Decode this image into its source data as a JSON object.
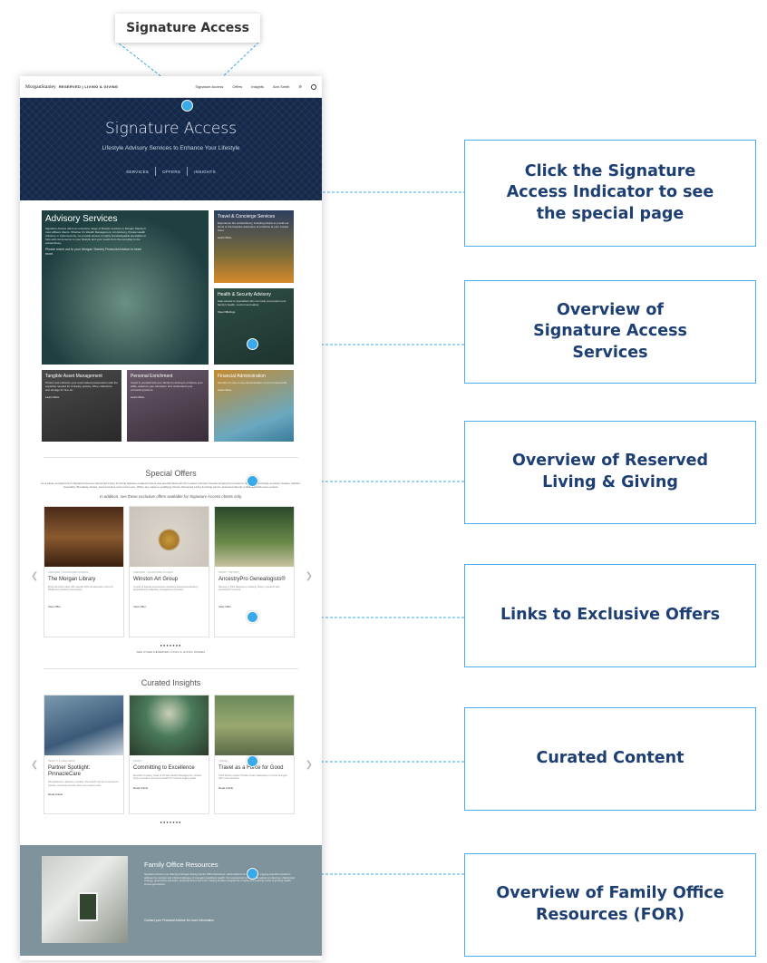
{
  "top_label": "Signature Access",
  "nav": {
    "logo": "MorganStanley",
    "brand": "RESERVED | LIVING & GIVING",
    "links": [
      "Signature Access",
      "Offers",
      "Insights",
      "Ann Smith"
    ]
  },
  "hero": {
    "title": "Signature Access",
    "subtitle": "Lifestyle Advisory Services to Enhance Your Lifestyle",
    "tabs": [
      "SERVICES",
      "OFFERS",
      "INSIGHTS"
    ]
  },
  "services": {
    "advisory": {
      "title": "Advisory Services",
      "body": "Signature Access offers an extensive range of lifestyle services to Morgan Stanley's most affluent clients. Whether it's Wealth Management, Art Advisory, Private Health Advisory or Cybersecurity, we provide access to highly knowledgeable specialists to help add convenience to your lifestyle and your needs from the everyday to the extraordinary.",
      "cta": "Please reach out to your Morgan Stanley Financial Advisor to learn more."
    },
    "travel": {
      "title": "Travel & Concierge Services",
      "body": "Experience the extraordinary, including tickets to a sold-out show or the bespoke adventure of a lifetime at your trusted hotel.",
      "link": "Learn More"
    },
    "health": {
      "title": "Health & Security Advisory",
      "body": "Gain access to specialists who can help you protect your family's health, comfort and safety.",
      "link": "View Offerings"
    },
    "tangible": {
      "title": "Tangible Asset Management",
      "body": "Protect and enhance your most valued possessions with the expertise needed for Antiquity, jewelry, Wine collections, and storage for fine art.",
      "link": "Learn More"
    },
    "personal": {
      "title": "Personal Enrichment",
      "body": "Invest in yourself and your family by aiming to enhance your skills, advance your education and understand your connecting factors.",
      "link": "Learn More"
    },
    "financial": {
      "title": "Financial Administration",
      "body": "Simplify the day to day administration of your financial life.",
      "link": "Learn More"
    }
  },
  "offers": {
    "title": "Special Offers",
    "intro": "As a value complement to Signature Access, Reserved Living & Giving features curated content and special discounts from select premium brands ranging from travel to rideshare, concierge services, theater, fashion, hospitality, Broadway shows, food and wine and much more. Offers are made to qualifying clients. Reserved Living & Giving can be accessed directly online and with some events.",
    "sub_intro": "In addition, see these exclusive offers available for Signature Access clients only.",
    "cards": [
      {
        "category": "CREATED | SIGNATURE ACCESS",
        "name": "The Morgan Library",
        "desc": "Bring the Floor early with special 10% off admission price for Reserved members and guests.",
        "link": "View Offer"
      },
      {
        "category": "CREATED | SIGNATURE ACCESS",
        "name": "Winston Art Group",
        "desc": "A suite of special experiences including discounted advisory, appraisal and collection management services.",
        "link": "View Offer"
      },
      {
        "category": "FAMILY HISTORY",
        "name": "AncestryPro Genealogists®",
        "desc": "Receive a 15% discount on sharing history research with AncestryPro experts.",
        "link": "View Offer"
      }
    ],
    "dots": "●●●●●●●",
    "see_all": "SEE OTHER RESERVED LIVING & GIVING OFFERS"
  },
  "insights": {
    "title": "Curated Insights",
    "cards": [
      {
        "category": "HEALTH & WELLNESS",
        "name": "Partner Spotlight: PinnacleCare",
        "desc": "PinnacleCare's advisory member, the world's top tier of access to private, concierge service when you need it most.",
        "link": "Read Article"
      },
      {
        "category": "FAMILY",
        "name": "Committing to Excellence",
        "desc": "Meredith Crowley, head of Private Wealth Management, shares how to preserve and grow wealth for a future legacy goals.",
        "link": "Read Article"
      },
      {
        "category": "TRAVEL",
        "name": "Travel as a Force for Good",
        "desc": "Chris Moran shares Private Impact takeaways to travel and give with more intention.",
        "link": "Read Article"
      }
    ],
    "dots": "●●●●●●●"
  },
  "family_office": {
    "title": "Family Office Resources",
    "body": "Signature Access is an offering of Morgan Stanley Family Office Resources, which delivers the value of the ongoing expertise needed to address the complex and critical challenges of managing significant wealth. Our experienced professionals advise on planning, philanthropic strategy, governance education, family dynamics and more, helping families navigate the complex and evolving needs of growing wealth across generations.",
    "cta": "Contact your Financial Advisor for more information"
  },
  "callouts": [
    "Click the Signature Access Indicator to see the special page",
    "Overview of Signature Access Services",
    "Overview of Reserved Living & Giving",
    "Links to Exclusive Offers",
    "Curated Content",
    "Overview of Family Office Resources (FOR)"
  ],
  "accent_color": "#39a9ea",
  "callout_text_color": "#1d3f73"
}
